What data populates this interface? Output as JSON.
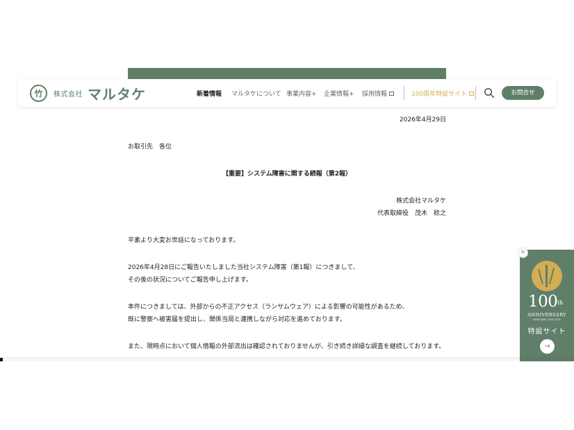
{
  "header": {
    "logo_mark": "竹",
    "company": "株式会社",
    "wordmark": "マルタケ",
    "nav": [
      {
        "label": "新着情報"
      },
      {
        "label": "マルタケについて"
      },
      {
        "label": "事業内容+"
      },
      {
        "label": "企業情報+"
      },
      {
        "label": "採用情報"
      },
      {
        "label": "100周年特設サイト"
      }
    ],
    "contact_label": "お問合せ"
  },
  "document": {
    "date": "2026年4月29日",
    "addressee": "お取引先　各位",
    "title": "【重要】システム障害に関する続報（第2報）",
    "sender_company": "株式会社マルタケ",
    "sender_person": "代表取締役　茂木　稔之",
    "p1": "平素より大変お世話になっております。",
    "p2_line1": "2026年4月28日にご報告いたしました当社システム障害（第1報）につきまして、",
    "p2_line2": "その後の状況についてご報告申し上げます。",
    "p3_line1": "本件につきましては、外部からの不正アクセス（ランサムウェア）による影響の可能性があるため、",
    "p3_line2": "既に警察へ被害届を提出し、関係当局と連携しながら対応を進めております。",
    "p4": "また、現時点において個人情報の外部流出は確認されておりませんが、引き続き詳細な調査を継続しております。"
  },
  "anniversary_banner": {
    "number": "100",
    "suffix": "th",
    "word": "ANNIVERSARY",
    "sub": "MARUTAKE 1926-2026",
    "site_label": "特設サイト",
    "close_icon": "×",
    "arrow_icon": "→"
  },
  "colors": {
    "brand_green": "#5f7f69",
    "gold": "#d3ad52"
  }
}
